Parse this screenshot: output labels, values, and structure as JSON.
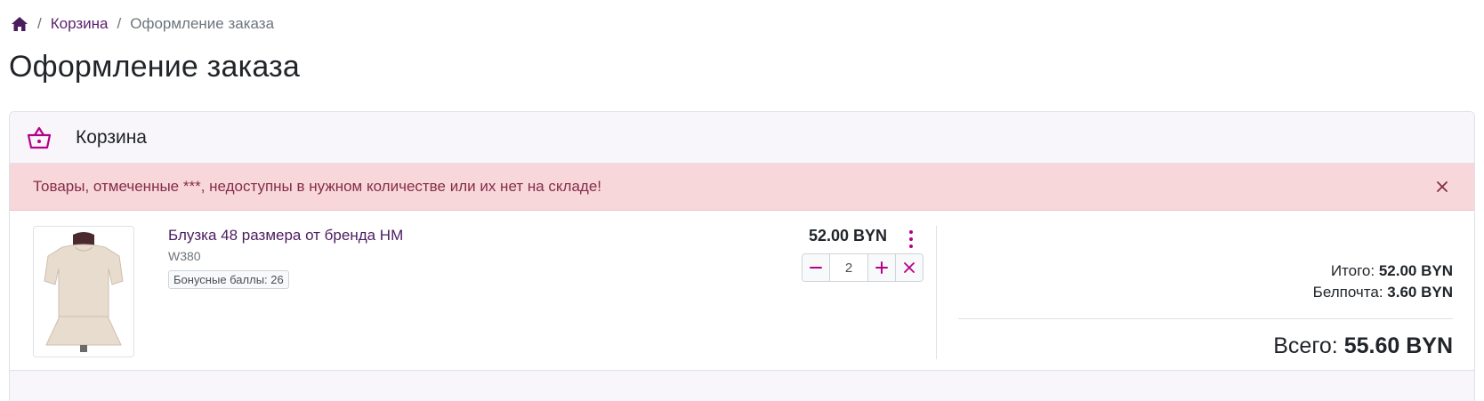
{
  "breadcrumb": {
    "home_icon": "home-icon",
    "separator": "/",
    "items": [
      "Корзина",
      "Оформление заказа"
    ]
  },
  "page_title": "Оформление заказа",
  "cart": {
    "header_icon": "basket-icon",
    "title": "Корзина",
    "alert": "Товары, отмеченные ***, недоступны в нужном количестве или их нет на складе!",
    "items": [
      {
        "name": "Блузка 48 размера от бренда НМ",
        "sku": "W380",
        "bonus": "Бонусные баллы: 26",
        "price": "52.00 BYN",
        "quantity": "2"
      }
    ],
    "summary": {
      "subtotal_label": "Итого:",
      "subtotal_value": "52.00 BYN",
      "shipping_label": "Белпочта:",
      "shipping_value": "3.60 BYN",
      "total_label": "Всего:",
      "total_value": "55.60 BYN"
    }
  },
  "colors": {
    "accent": "#b5008a",
    "link": "#5a1f6e",
    "alert_bg": "#f8d7da",
    "alert_text": "#842d49"
  }
}
